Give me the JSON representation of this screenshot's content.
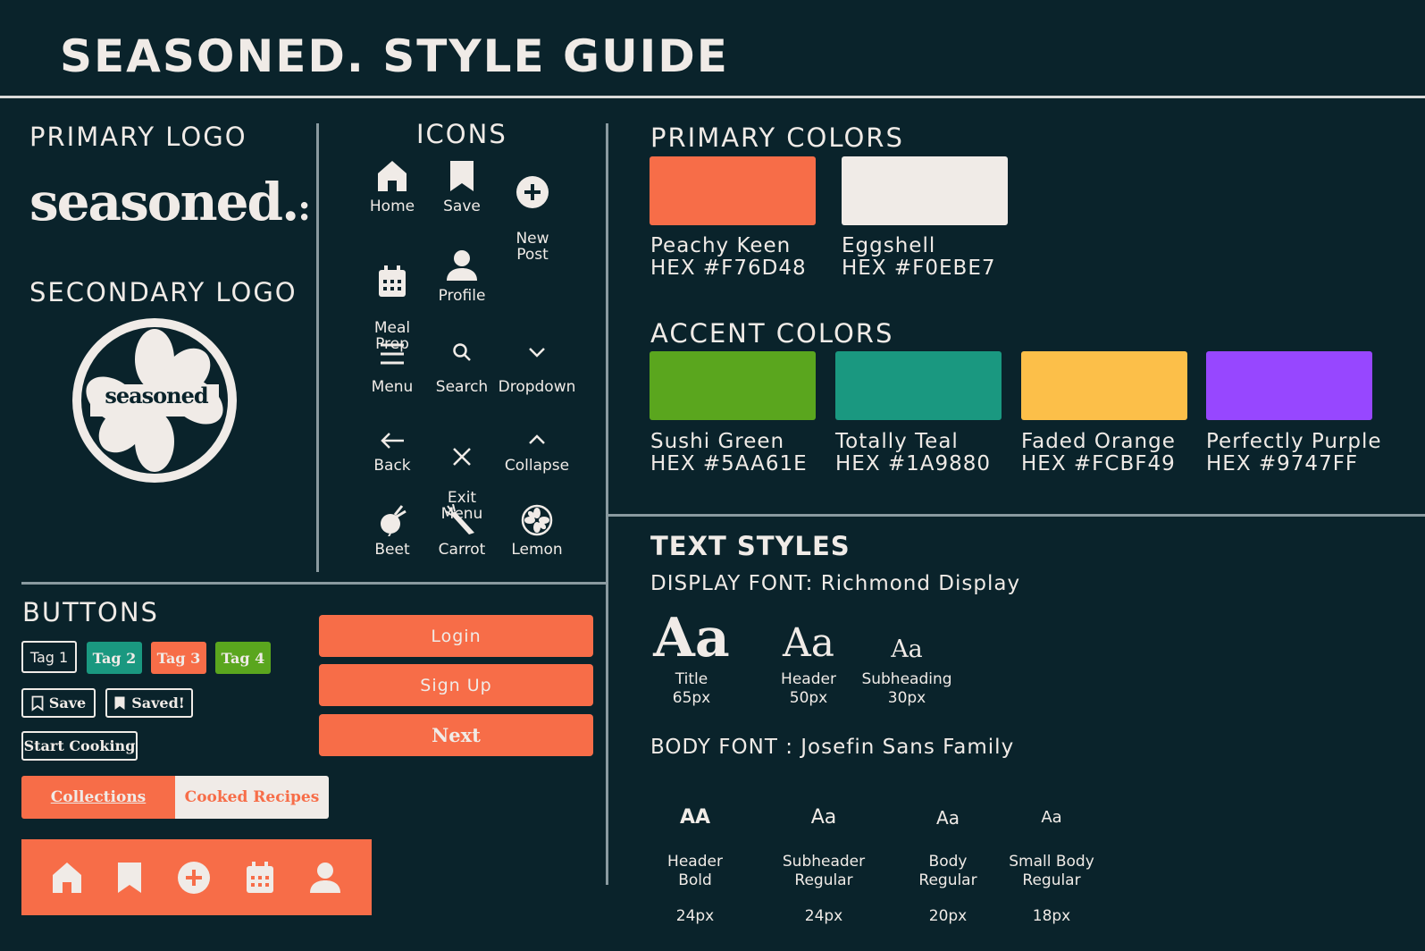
{
  "title": "SEASONED. STYLE GUIDE",
  "logos": {
    "primary_heading": "PRIMARY LOGO",
    "primary_wordmark": "seasoned.",
    "secondary_heading": "SECONDARY LOGO",
    "secondary_wordmark": "seasoned"
  },
  "icons": {
    "heading": "ICONS",
    "items": [
      {
        "label": "Home",
        "icon": "home-icon"
      },
      {
        "label": "Save",
        "icon": "bookmark-icon"
      },
      {
        "label": "New\nPost",
        "icon": "plus-circle-icon"
      },
      {
        "label": "Meal\nPrep",
        "icon": "calendar-icon"
      },
      {
        "label": "Profile",
        "icon": "user-icon"
      },
      {
        "label": "Menu",
        "icon": "hamburger-menu-icon"
      },
      {
        "label": "Search",
        "icon": "search-icon"
      },
      {
        "label": "Dropdown",
        "icon": "chevron-down-icon"
      },
      {
        "label": "Back",
        "icon": "arrow-left-icon"
      },
      {
        "label": "Exit\nMenu",
        "icon": "close-icon"
      },
      {
        "label": "Collapse",
        "icon": "chevron-up-icon"
      },
      {
        "label": "Beet",
        "icon": "beet-icon"
      },
      {
        "label": "Carrot",
        "icon": "carrot-icon"
      },
      {
        "label": "Lemon",
        "icon": "lemon-icon"
      }
    ]
  },
  "buttons": {
    "heading": "BUTTONS",
    "tags": [
      "Tag 1",
      "Tag 2",
      "Tag 3",
      "Tag 4"
    ],
    "save": "Save",
    "saved": "Saved!",
    "start_cooking": "Start Cooking",
    "login": "Login",
    "sign_up": "Sign Up",
    "next": "Next",
    "segment_active": "Collections",
    "segment_inactive": "Cooked Recipes",
    "nav_icons": [
      "home-icon",
      "bookmark-icon",
      "plus-circle-icon",
      "calendar-icon",
      "user-icon"
    ]
  },
  "primary_colors": {
    "heading": "PRIMARY COLORS",
    "items": [
      {
        "name": "Peachy Keen",
        "hex_label": "HEX #F76D48",
        "color": "#F76D48"
      },
      {
        "name": "Eggshell",
        "hex_label": "HEX #F0EBE7",
        "color": "#F0EBE7"
      }
    ]
  },
  "accent_colors": {
    "heading": "ACCENT COLORS",
    "items": [
      {
        "name": "Sushi Green",
        "hex_label": "HEX #5AA61E",
        "color": "#5AA61E"
      },
      {
        "name": "Totally Teal",
        "hex_label": "HEX #1A9880",
        "color": "#1A9880"
      },
      {
        "name": "Faded Orange",
        "hex_label": "HEX #FCBF49",
        "color": "#FCBF49"
      },
      {
        "name": "Perfectly Purple",
        "hex_label": "HEX #9747FF",
        "color": "#9747FF"
      }
    ]
  },
  "text_styles": {
    "heading": "TEXT STYLES",
    "display_font_label": "DISPLAY FONT: Richmond Display",
    "display_samples": [
      {
        "glyph": "Aa",
        "name": "Title",
        "size": "65px"
      },
      {
        "glyph": "Aa",
        "name": "Header",
        "size": "50px"
      },
      {
        "glyph": "Aa",
        "name": "Subheading",
        "size": "30px"
      }
    ],
    "body_font_label": "BODY FONT : Josefin Sans Family",
    "body_samples": [
      {
        "glyph": "AA",
        "name": "Header\nBold",
        "size": "24px"
      },
      {
        "glyph": "Aa",
        "name": "Subheader\nRegular",
        "size": "24px"
      },
      {
        "glyph": "Aa",
        "name": "Body\nRegular",
        "size": "20px"
      },
      {
        "glyph": "Aa",
        "name": "Small Body\nRegular",
        "size": "18px"
      }
    ]
  }
}
